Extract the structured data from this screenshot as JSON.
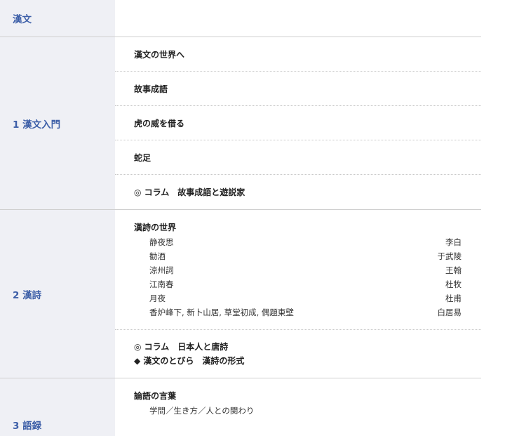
{
  "header": {
    "title": "漢文"
  },
  "sections": [
    {
      "label": "1 漢文入門",
      "entries": [
        "漢文の世界へ",
        "故事成語",
        "虎の威を借る",
        "蛇足",
        "◎ コラム　故事成語と遊説家"
      ]
    },
    {
      "label": "2 漢詩",
      "group_title": "漢詩の世界",
      "poems": [
        {
          "title": "静夜思",
          "author": "李白"
        },
        {
          "title": "勧酒",
          "author": "于武陵"
        },
        {
          "title": "涼州詞",
          "author": "王翰"
        },
        {
          "title": "江南春",
          "author": "杜牧"
        },
        {
          "title": "月夜",
          "author": "杜甫"
        },
        {
          "title": "香炉峰下, 新卜山居, 草堂初成, 偶題東壁",
          "author": "白居易"
        }
      ],
      "column": "◎ コラム　日本人と唐詩",
      "extra": "◆ 漢文のとびら　漢詩の形式"
    },
    {
      "label": "3 語録",
      "group_title": "論語の言葉",
      "sub": "学問／生き方／人との関わり"
    }
  ]
}
